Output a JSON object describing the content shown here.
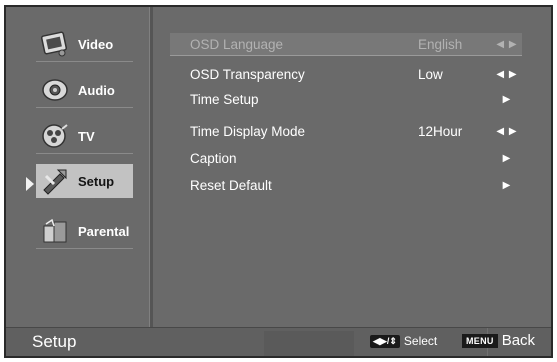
{
  "sidebar": {
    "items": [
      {
        "label": "Video",
        "icon": "video-icon"
      },
      {
        "label": "Audio",
        "icon": "audio-icon"
      },
      {
        "label": "TV",
        "icon": "tv-icon"
      },
      {
        "label": "Setup",
        "icon": "setup-icon",
        "active": true
      },
      {
        "label": "Parental",
        "icon": "parental-icon"
      }
    ]
  },
  "menu": {
    "rows": [
      {
        "label": "OSD Language",
        "value": "English",
        "nav": "◀ ▶",
        "state": "highlighted"
      },
      {
        "label": "OSD Transparency",
        "value": "Low",
        "nav": "◀ ▶"
      },
      {
        "label": "Time Setup",
        "value": "",
        "nav": "▶"
      },
      {
        "label": "Time Display Mode",
        "value": "12Hour",
        "nav": "◀ ▶"
      },
      {
        "label": "Caption",
        "value": "",
        "nav": "▶"
      },
      {
        "label": "Reset Default",
        "value": "",
        "nav": "▶"
      }
    ]
  },
  "bottom": {
    "title": "Setup",
    "select_keys": "◀▶/⇕",
    "select_label": "Select",
    "menu_key": "MENU",
    "back_label": "Back"
  },
  "colors": {
    "background": "#6a6a6a",
    "active_tab": "#c2c2c2",
    "text": "#ffffff"
  }
}
